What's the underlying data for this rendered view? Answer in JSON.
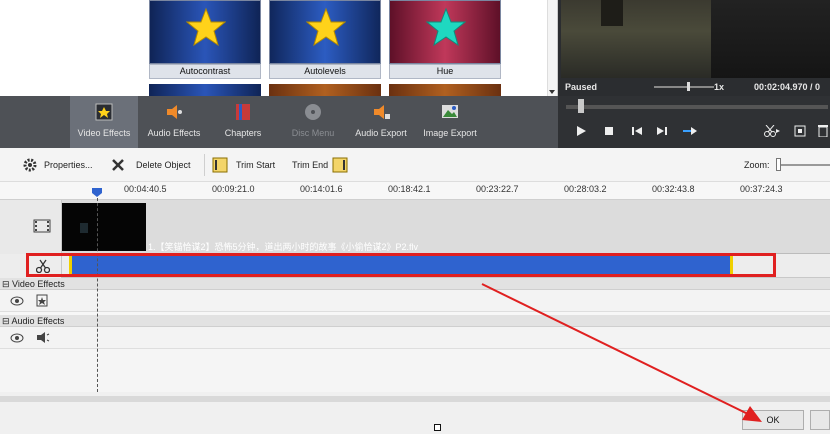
{
  "effects": {
    "tiles": [
      {
        "label": "Autocontrast",
        "bg": "#1c3a7a",
        "star": "#ffd21a"
      },
      {
        "label": "Autolevels",
        "bg": "#1f3f86",
        "star": "#ffd21a"
      },
      {
        "label": "Hue",
        "bg": "#9a2040",
        "star": "#1fd8c0"
      }
    ]
  },
  "preview": {
    "status": "Paused",
    "speed": "1x",
    "time": "00:02:04.970 / 0"
  },
  "toolbar": {
    "items": [
      {
        "label": "Video Effects",
        "icon": "video-effects-icon",
        "active": true
      },
      {
        "label": "Audio Effects",
        "icon": "audio-effects-icon",
        "active": false
      },
      {
        "label": "Chapters",
        "icon": "chapters-icon",
        "active": false
      },
      {
        "label": "Disc Menu",
        "icon": "disc-menu-icon",
        "active": false,
        "disabled": true
      },
      {
        "label": "Audio Export",
        "icon": "audio-export-icon",
        "active": false
      },
      {
        "label": "Image Export",
        "icon": "image-export-icon",
        "active": false
      }
    ]
  },
  "edit_toolbar": {
    "properties": "Properties...",
    "delete": "Delete Object",
    "trim_start": "Trim Start",
    "trim_end": "Trim End",
    "zoom": "Zoom:"
  },
  "ruler": {
    "ticks": [
      "00:04:40.5",
      "00:09:21.0",
      "00:14:01.6",
      "00:18:42.1",
      "00:23:22.7",
      "00:28:03.2",
      "00:32:43.8",
      "00:37:24.3"
    ]
  },
  "timeline": {
    "clip_title": "1.【笑锚恰谋2】恐怖5分钟，道出两小时的故事《小偷恰谋2》P2.flv",
    "video_effects_label": "Video Effects",
    "audio_effects_label": "Audio Effects"
  },
  "dialog": {
    "ok": "OK"
  },
  "colors": {
    "accent": "#2f63cf",
    "highlight": "#e02020",
    "trim_marker": "#f0d000"
  }
}
